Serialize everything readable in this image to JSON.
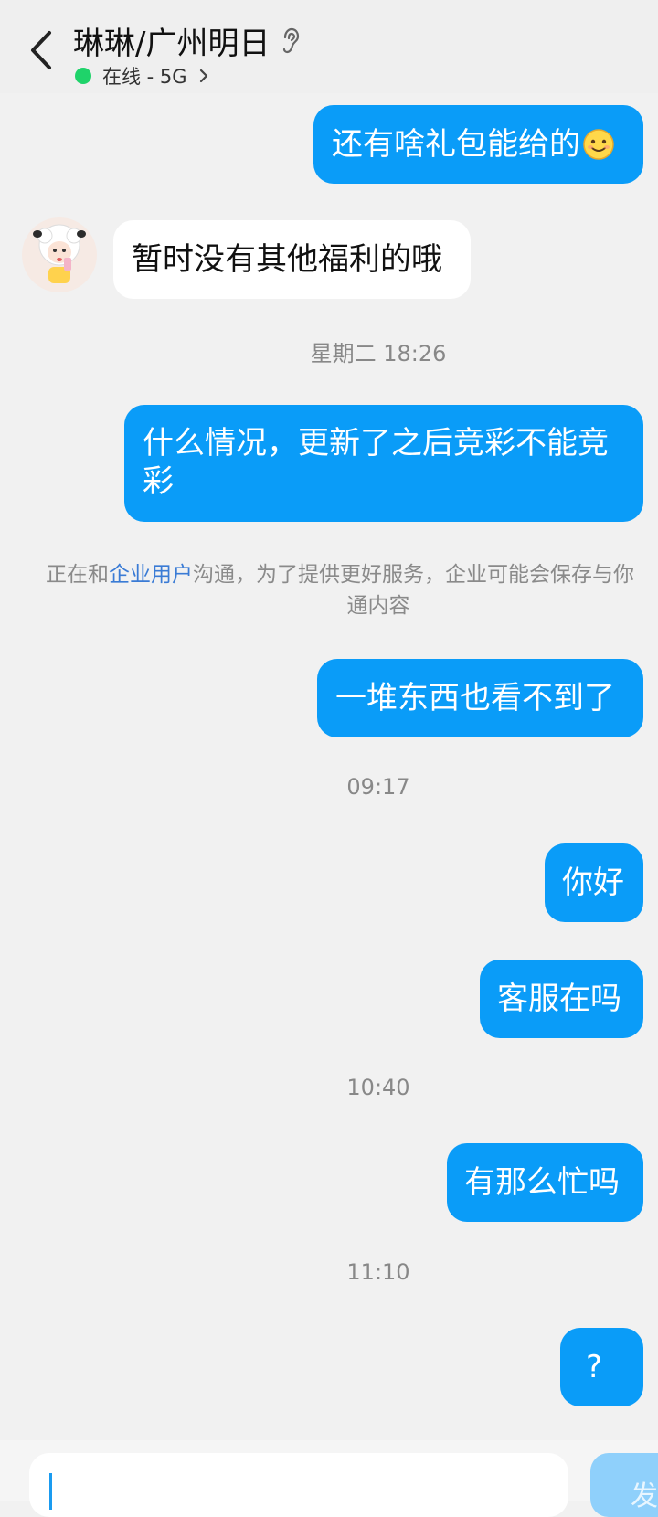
{
  "header": {
    "title": "琳琳/广州明日",
    "status": "在线 - 5G",
    "colors": {
      "online": "#1fd36a"
    }
  },
  "messages": [
    {
      "dir": "out",
      "text": "还有啥礼包能给的",
      "emoji": "smile-emoji"
    },
    {
      "dir": "in",
      "text": "暂时没有其他福利的哦"
    },
    {
      "time": "星期二 18:26"
    },
    {
      "dir": "out",
      "text": "什么情况，更新了之后竞彩不能竞彩"
    },
    {
      "notice": {
        "before": "正在和",
        "link": "企业用户",
        "after": "沟通，为了提供更好服务，企业可能会保存与你",
        "line2": "通内容"
      }
    },
    {
      "dir": "out",
      "text": "一堆东西也看不到了"
    },
    {
      "time": "09:17"
    },
    {
      "dir": "out",
      "text": "你好"
    },
    {
      "dir": "out",
      "text": "客服在吗"
    },
    {
      "time": "10:40"
    },
    {
      "dir": "out",
      "text": "有那么忙吗"
    },
    {
      "time": "11:10"
    },
    {
      "dir": "out",
      "text": "?"
    }
  ],
  "composer": {
    "send_label": "发",
    "colors": {
      "bubble_out": "#0a9cf8",
      "send_disabled": "#8fd0fb"
    }
  }
}
